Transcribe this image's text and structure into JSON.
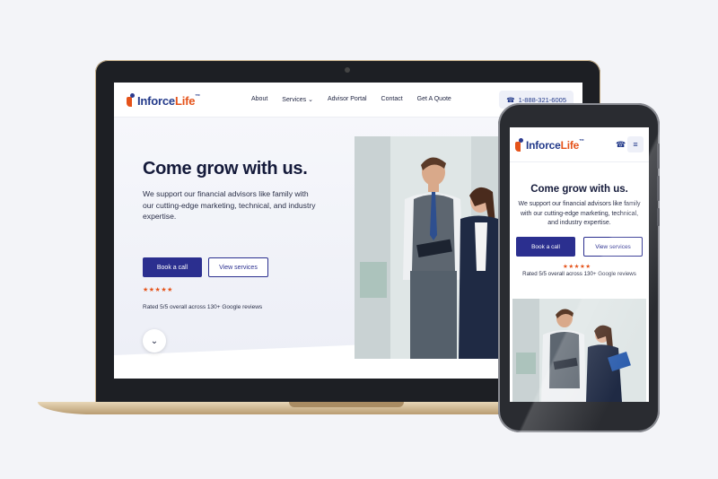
{
  "brand": {
    "name_part1": "Inforce",
    "name_part2": "Life",
    "trademark": "™"
  },
  "nav": {
    "items": [
      "About",
      "Services",
      "Advisor Portal",
      "Contact",
      "Get A Quote"
    ],
    "phone": "1-888-321-6005"
  },
  "hero": {
    "title": "Come grow with us.",
    "subtitle": "We support our financial advisors like family with our cutting-edge marketing, technical, and industry expertise.",
    "primary_button": "Book a call",
    "secondary_button": "View services",
    "stars": "★★★★★",
    "rating_text": "Rated 5/5 overall across 130+ Google reviews"
  },
  "icons": {
    "phone": "☎",
    "menu": "≡",
    "chevron_down": "⌄",
    "scroll_down": "⌄"
  },
  "colors": {
    "brand_blue": "#2b2f8f",
    "brand_orange": "#e5531a"
  }
}
